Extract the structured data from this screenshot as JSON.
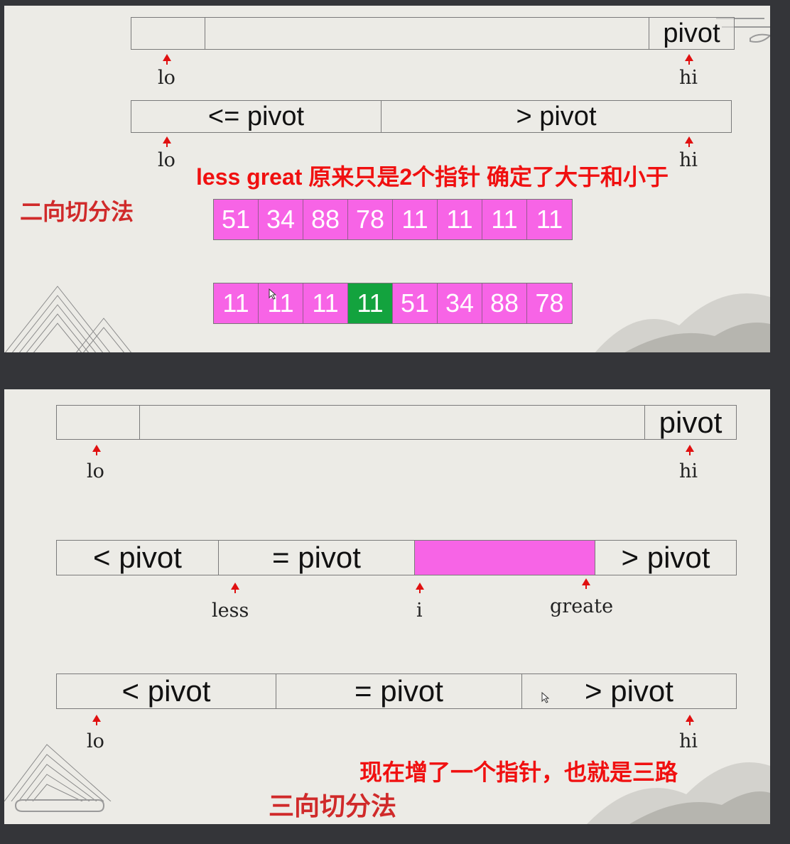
{
  "slide1": {
    "bar1": {
      "segments": [
        "",
        "",
        "pivot"
      ]
    },
    "bar2": {
      "segments": [
        "<= pivot",
        "> pivot"
      ]
    },
    "labels": {
      "lo": "lo",
      "hi": "hi"
    },
    "annotation": "less great 原来只是2个指针 确定了大于和小于",
    "method": "二向切分法",
    "array_before": [
      "51",
      "34",
      "88",
      "78",
      "11",
      "11",
      "11",
      "11"
    ],
    "array_after": [
      "11",
      "11",
      "11",
      "11",
      "51",
      "34",
      "88",
      "78"
    ],
    "highlight_index": 3,
    "colors": {
      "cell": "#f764e6",
      "highlight": "#13a33e",
      "arrow": "#e01010"
    }
  },
  "slide2": {
    "bar1": {
      "segments": [
        "",
        "",
        "pivot"
      ]
    },
    "bar2": {
      "segments": [
        "< pivot",
        "= pivot",
        "",
        "> pivot"
      ]
    },
    "bar3": {
      "segments": [
        "< pivot",
        "= pivot",
        "> pivot"
      ]
    },
    "labels": {
      "lo": "lo",
      "hi": "hi",
      "less": "less",
      "i": "i",
      "greate": "greate"
    },
    "annotation": "现在增了一个指针，也就是三路",
    "method": "三向切分法"
  }
}
